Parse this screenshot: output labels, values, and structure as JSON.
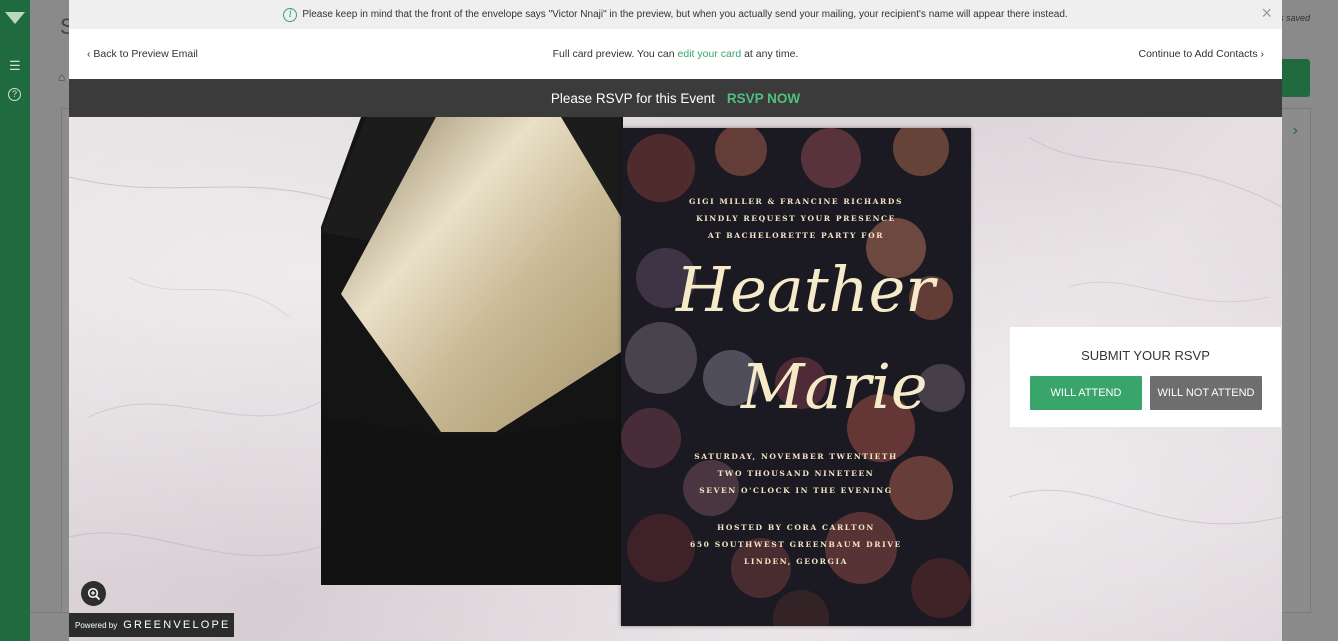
{
  "background": {
    "saved_text": "is saved",
    "title_initial": "S",
    "home_icon": "home-icon"
  },
  "notice": {
    "text": "Please keep in mind that the front of the envelope says \"Victor Nnaji\" in the preview, but when you actually send your mailing, your recipient's name will appear there instead.",
    "info_icon": "i",
    "close_icon": "×"
  },
  "nav": {
    "back_label": "Back to Preview Email",
    "center_text_before": "Full card preview. You can ",
    "center_link": "edit your card",
    "center_text_after": " at any time.",
    "continue_label": "Continue to Add Contacts"
  },
  "rsvp_bar": {
    "label": "Please RSVP for this Event",
    "cta": "RSVP NOW"
  },
  "card": {
    "line1": "GIGI MILLER & FRANCINE RICHARDS",
    "line2": "KINDLY REQUEST YOUR PRESENCE",
    "line3": "AT BACHELORETTE PARTY FOR",
    "name_first": "Heather",
    "name_second": "Marie",
    "date1": "SATURDAY, NOVEMBER TWENTIETH",
    "date2": "TWO THOUSAND NINETEEN",
    "date3": "SEVEN O'CLOCK IN THE EVENING",
    "host": "HOSTED BY CORA CARLTON",
    "address1": "650 SOUTHWEST GREENBAUM DRIVE",
    "address2": "LINDEN, GEORGIA"
  },
  "rsvp_panel": {
    "title": "SUBMIT YOUR RSVP",
    "attend": "WILL ATTEND",
    "not_attend": "WILL NOT ATTEND"
  },
  "footer": {
    "powered_by": "Powered by",
    "brand": "GREENVELOPE"
  },
  "colors": {
    "accent_green": "#3aa56a",
    "dark_bar": "#3b3b3b",
    "sidebar_green": "#1f6b3f",
    "gold": "#f3e6c4"
  }
}
